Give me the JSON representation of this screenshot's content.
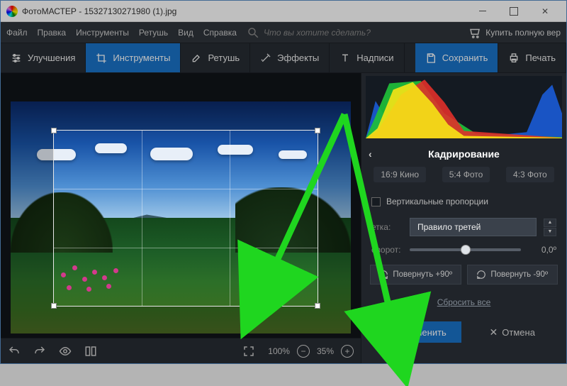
{
  "window": {
    "title": "ФотоМАСТЕР - 15327130271980 (1).jpg"
  },
  "menubar": {
    "items": [
      "Файл",
      "Правка",
      "Инструменты",
      "Ретушь",
      "Вид",
      "Справка"
    ],
    "search_placeholder": "Что вы хотите сделать?",
    "buy": "Купить полную вер"
  },
  "toolbar": {
    "enhance": "Улучшения",
    "tools": "Инструменты",
    "retouch": "Ретушь",
    "effects": "Эффекты",
    "text": "Надписи",
    "save": "Сохранить",
    "print": "Печать"
  },
  "bottombar": {
    "zoom1": "100%",
    "zoom2": "35%"
  },
  "panel": {
    "title": "Кадрирование",
    "ratios": {
      "r169": "16:9 Кино",
      "r54": "5:4 Фото",
      "r43": "4:3 Фото"
    },
    "vertical_prop": "Вертикальные пропорции",
    "grid_label": "етка:",
    "grid_value": "Правило третей",
    "rotate_label": "оворот:",
    "rotate_value": "0,0º",
    "rot_plus": "Повернуть +90º",
    "rot_minus": "Повернуть -90º",
    "reset": "Сбросить все",
    "apply": "Применить",
    "cancel": "Отмена"
  }
}
